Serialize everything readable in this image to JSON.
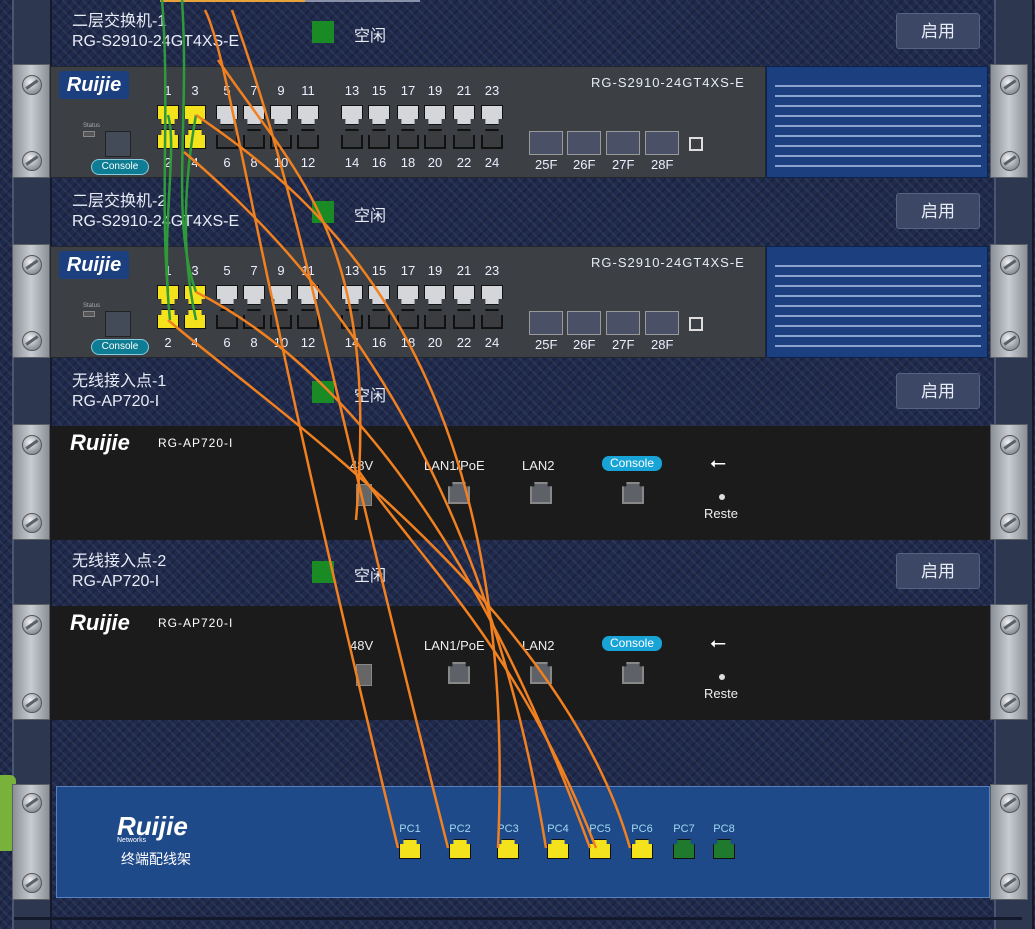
{
  "devices": [
    {
      "name": "二层交换机-1",
      "model": "RG-S2910-24GT4XS-E",
      "status": "空闲",
      "button": "启用",
      "panel_model": "RG-S2910-24GT4XS-E"
    },
    {
      "name": "二层交换机-2",
      "model": "RG-S2910-24GT4XS-E",
      "status": "空闲",
      "button": "启用",
      "panel_model": "RG-S2910-24GT4XS-E"
    },
    {
      "name": "无线接入点-1",
      "model": "RG-AP720-I",
      "status": "空闲",
      "button": "启用"
    },
    {
      "name": "无线接入点-2",
      "model": "RG-AP720-I",
      "status": "空闲",
      "button": "启用"
    }
  ],
  "switch_panel": {
    "brand": "Ruijie",
    "console": "Console",
    "status_label": "Status",
    "top_ports": [
      "1",
      "3",
      "5",
      "7",
      "9",
      "11",
      "13",
      "15",
      "17",
      "19",
      "21",
      "23"
    ],
    "bottom_ports": [
      "2",
      "4",
      "6",
      "8",
      "10",
      "12",
      "14",
      "16",
      "18",
      "20",
      "22",
      "24"
    ],
    "sfp_ports": [
      "25F",
      "26F",
      "27F",
      "28F"
    ]
  },
  "ap_panel": {
    "brand": "Ruijie",
    "model": "RG-AP720-I",
    "power": "48V",
    "lan1": "LAN1/PoE",
    "lan2": "LAN2",
    "console": "Console",
    "reset": "Reste"
  },
  "patch_panel": {
    "brand": "Ruijie",
    "sub": "Networks",
    "title": "终端配线架",
    "ports": [
      "PC1",
      "PC2",
      "PC3",
      "PC4",
      "PC5",
      "PC6",
      "PC7",
      "PC8"
    ]
  },
  "colors": {
    "cable": "#f08020",
    "green_cable": "#2f9a3a",
    "port_active": "#f4e21d",
    "port_idle": "#1f7a2e",
    "status_green": "#1a8a24"
  }
}
